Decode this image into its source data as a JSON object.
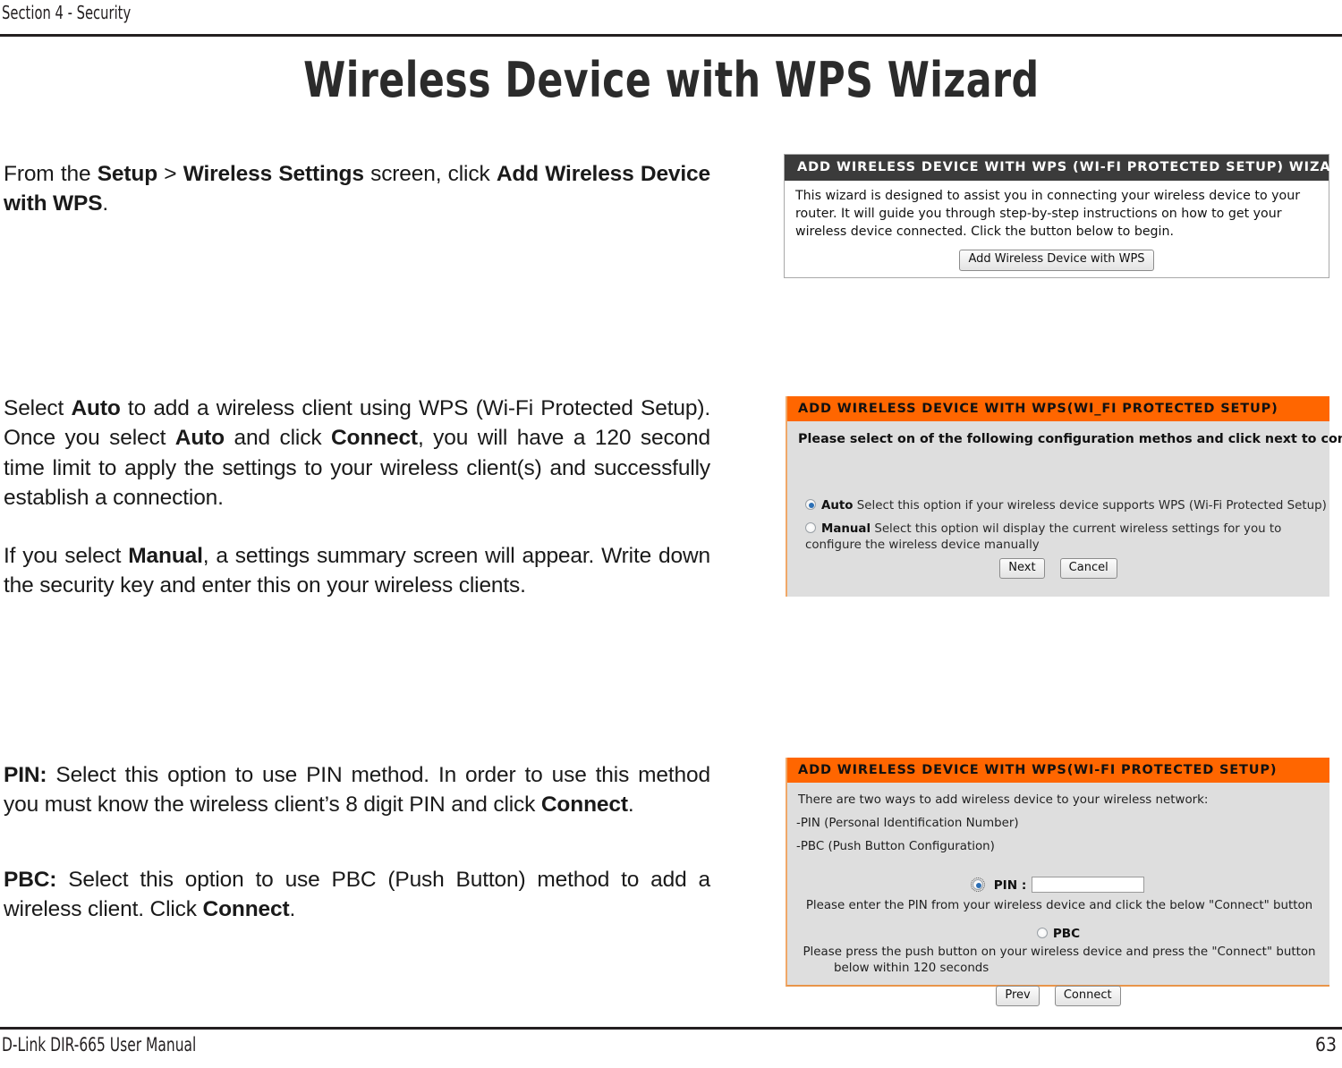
{
  "header": {
    "section_label": "Section 4 - Security"
  },
  "title": "Wireless Device with WPS Wizard",
  "body": {
    "par1": {
      "s1": "From the ",
      "b1": "Setup",
      "s2": " > ",
      "b2": "Wireless Settings",
      "s3": " screen, click ",
      "b3": "Add Wireless Device with WPS",
      "s4": "."
    },
    "par2": {
      "s1": "Select ",
      "b1": "Auto",
      "s2": " to add a wireless client using WPS (Wi-Fi Protected Setup). Once you select ",
      "b2": "Auto",
      "s3": " and click ",
      "b3": "Connect",
      "s4": ", you will have a 120 second time limit to apply the settings to your wireless client(s) and successfully establish a connection."
    },
    "par3": {
      "s1": "If you select ",
      "b1": "Manual",
      "s2": ", a settings summary screen will appear. Write down the security key and enter this on your wireless clients."
    },
    "par4": {
      "b1": "PIN:",
      "s1": " Select this option to use PIN method. In order to use this method you must know the wireless client’s 8 digit PIN and click ",
      "b2": "Connect",
      "s2": "."
    },
    "par5": {
      "b1": "PBC:",
      "s1": " Select this option to use PBC (Push Button) method to add a wireless client. Click ",
      "b2": "Connect",
      "s2": "."
    }
  },
  "panel_wizard": {
    "header": "ADD WIRELESS DEVICE WITH WPS (WI-FI PROTECTED SETUP) WIZARD",
    "body_text": "This wizard is designed to assist you in connecting your wireless device to your router. It will guide you through step-by-step instructions on how to get your wireless device connected. Click the button below to begin.",
    "button": "Add Wireless Device with WPS"
  },
  "panel_method": {
    "header": "ADD WIRELESS DEVICE WITH WPS(WI_FI PROTECTED SETUP)",
    "lead": "Please select on of the following configuration methos and click next to continue.",
    "option_auto_label": "Auto",
    "option_auto_text": " Select this option if your wireless device supports WPS (Wi-Fi Protected Setup)",
    "option_manual_label": "Manual",
    "option_manual_text": " Select this option wil display the current wireless settings for you to configure the wireless device manually",
    "button_next": "Next",
    "button_cancel": "Cancel",
    "selected_option": "Auto"
  },
  "panel_pin": {
    "header": "ADD WIRELESS DEVICE WITH WPS(WI-FI PROTECTED SETUP)",
    "line1": "There are two ways to add wireless device to your wireless network:",
    "line2": "-PIN (Personal Identification Number)",
    "line3": "-PBC (Push Button Configuration)",
    "pin_label": "PIN :",
    "pin_value": "",
    "pin_help": "Please enter the PIN from your wireless device and click the below \"Connect\" button",
    "pbc_label": "PBC",
    "pbc_help_line1": "Please press the push button on your wireless device and press the \"Connect\" button",
    "pbc_help_line2": "below within 120 seconds",
    "button_prev": "Prev",
    "button_connect": "Connect",
    "selected_option": "PIN"
  },
  "footer": {
    "left": "D-Link DIR-665 User Manual",
    "right": "63"
  },
  "colors": {
    "orange_bar": "#ff6600",
    "dark_bar": "#3b3b3b",
    "panel_gray": "#dedede",
    "rule": "#231f20",
    "radio_dot": "#2c6fb5"
  }
}
